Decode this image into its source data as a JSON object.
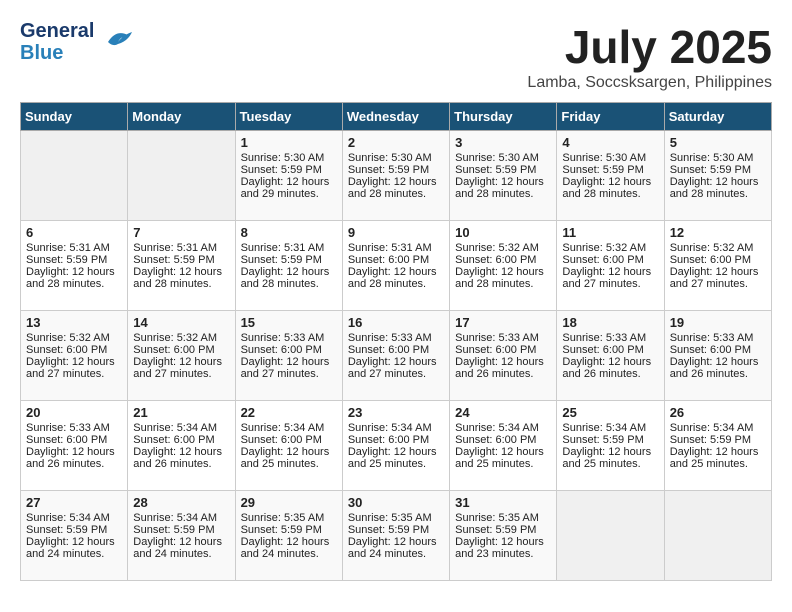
{
  "header": {
    "logo_line1": "General",
    "logo_line2": "Blue",
    "month": "July 2025",
    "location": "Lamba, Soccsksargen, Philippines"
  },
  "weekdays": [
    "Sunday",
    "Monday",
    "Tuesday",
    "Wednesday",
    "Thursday",
    "Friday",
    "Saturday"
  ],
  "weeks": [
    [
      {
        "day": "",
        "sunrise": "",
        "sunset": "",
        "daylight": ""
      },
      {
        "day": "",
        "sunrise": "",
        "sunset": "",
        "daylight": ""
      },
      {
        "day": "1",
        "sunrise": "Sunrise: 5:30 AM",
        "sunset": "Sunset: 5:59 PM",
        "daylight": "Daylight: 12 hours and 29 minutes."
      },
      {
        "day": "2",
        "sunrise": "Sunrise: 5:30 AM",
        "sunset": "Sunset: 5:59 PM",
        "daylight": "Daylight: 12 hours and 28 minutes."
      },
      {
        "day": "3",
        "sunrise": "Sunrise: 5:30 AM",
        "sunset": "Sunset: 5:59 PM",
        "daylight": "Daylight: 12 hours and 28 minutes."
      },
      {
        "day": "4",
        "sunrise": "Sunrise: 5:30 AM",
        "sunset": "Sunset: 5:59 PM",
        "daylight": "Daylight: 12 hours and 28 minutes."
      },
      {
        "day": "5",
        "sunrise": "Sunrise: 5:30 AM",
        "sunset": "Sunset: 5:59 PM",
        "daylight": "Daylight: 12 hours and 28 minutes."
      }
    ],
    [
      {
        "day": "6",
        "sunrise": "Sunrise: 5:31 AM",
        "sunset": "Sunset: 5:59 PM",
        "daylight": "Daylight: 12 hours and 28 minutes."
      },
      {
        "day": "7",
        "sunrise": "Sunrise: 5:31 AM",
        "sunset": "Sunset: 5:59 PM",
        "daylight": "Daylight: 12 hours and 28 minutes."
      },
      {
        "day": "8",
        "sunrise": "Sunrise: 5:31 AM",
        "sunset": "Sunset: 5:59 PM",
        "daylight": "Daylight: 12 hours and 28 minutes."
      },
      {
        "day": "9",
        "sunrise": "Sunrise: 5:31 AM",
        "sunset": "Sunset: 6:00 PM",
        "daylight": "Daylight: 12 hours and 28 minutes."
      },
      {
        "day": "10",
        "sunrise": "Sunrise: 5:32 AM",
        "sunset": "Sunset: 6:00 PM",
        "daylight": "Daylight: 12 hours and 28 minutes."
      },
      {
        "day": "11",
        "sunrise": "Sunrise: 5:32 AM",
        "sunset": "Sunset: 6:00 PM",
        "daylight": "Daylight: 12 hours and 27 minutes."
      },
      {
        "day": "12",
        "sunrise": "Sunrise: 5:32 AM",
        "sunset": "Sunset: 6:00 PM",
        "daylight": "Daylight: 12 hours and 27 minutes."
      }
    ],
    [
      {
        "day": "13",
        "sunrise": "Sunrise: 5:32 AM",
        "sunset": "Sunset: 6:00 PM",
        "daylight": "Daylight: 12 hours and 27 minutes."
      },
      {
        "day": "14",
        "sunrise": "Sunrise: 5:32 AM",
        "sunset": "Sunset: 6:00 PM",
        "daylight": "Daylight: 12 hours and 27 minutes."
      },
      {
        "day": "15",
        "sunrise": "Sunrise: 5:33 AM",
        "sunset": "Sunset: 6:00 PM",
        "daylight": "Daylight: 12 hours and 27 minutes."
      },
      {
        "day": "16",
        "sunrise": "Sunrise: 5:33 AM",
        "sunset": "Sunset: 6:00 PM",
        "daylight": "Daylight: 12 hours and 27 minutes."
      },
      {
        "day": "17",
        "sunrise": "Sunrise: 5:33 AM",
        "sunset": "Sunset: 6:00 PM",
        "daylight": "Daylight: 12 hours and 26 minutes."
      },
      {
        "day": "18",
        "sunrise": "Sunrise: 5:33 AM",
        "sunset": "Sunset: 6:00 PM",
        "daylight": "Daylight: 12 hours and 26 minutes."
      },
      {
        "day": "19",
        "sunrise": "Sunrise: 5:33 AM",
        "sunset": "Sunset: 6:00 PM",
        "daylight": "Daylight: 12 hours and 26 minutes."
      }
    ],
    [
      {
        "day": "20",
        "sunrise": "Sunrise: 5:33 AM",
        "sunset": "Sunset: 6:00 PM",
        "daylight": "Daylight: 12 hours and 26 minutes."
      },
      {
        "day": "21",
        "sunrise": "Sunrise: 5:34 AM",
        "sunset": "Sunset: 6:00 PM",
        "daylight": "Daylight: 12 hours and 26 minutes."
      },
      {
        "day": "22",
        "sunrise": "Sunrise: 5:34 AM",
        "sunset": "Sunset: 6:00 PM",
        "daylight": "Daylight: 12 hours and 25 minutes."
      },
      {
        "day": "23",
        "sunrise": "Sunrise: 5:34 AM",
        "sunset": "Sunset: 6:00 PM",
        "daylight": "Daylight: 12 hours and 25 minutes."
      },
      {
        "day": "24",
        "sunrise": "Sunrise: 5:34 AM",
        "sunset": "Sunset: 6:00 PM",
        "daylight": "Daylight: 12 hours and 25 minutes."
      },
      {
        "day": "25",
        "sunrise": "Sunrise: 5:34 AM",
        "sunset": "Sunset: 5:59 PM",
        "daylight": "Daylight: 12 hours and 25 minutes."
      },
      {
        "day": "26",
        "sunrise": "Sunrise: 5:34 AM",
        "sunset": "Sunset: 5:59 PM",
        "daylight": "Daylight: 12 hours and 25 minutes."
      }
    ],
    [
      {
        "day": "27",
        "sunrise": "Sunrise: 5:34 AM",
        "sunset": "Sunset: 5:59 PM",
        "daylight": "Daylight: 12 hours and 24 minutes."
      },
      {
        "day": "28",
        "sunrise": "Sunrise: 5:34 AM",
        "sunset": "Sunset: 5:59 PM",
        "daylight": "Daylight: 12 hours and 24 minutes."
      },
      {
        "day": "29",
        "sunrise": "Sunrise: 5:35 AM",
        "sunset": "Sunset: 5:59 PM",
        "daylight": "Daylight: 12 hours and 24 minutes."
      },
      {
        "day": "30",
        "sunrise": "Sunrise: 5:35 AM",
        "sunset": "Sunset: 5:59 PM",
        "daylight": "Daylight: 12 hours and 24 minutes."
      },
      {
        "day": "31",
        "sunrise": "Sunrise: 5:35 AM",
        "sunset": "Sunset: 5:59 PM",
        "daylight": "Daylight: 12 hours and 23 minutes."
      },
      {
        "day": "",
        "sunrise": "",
        "sunset": "",
        "daylight": ""
      },
      {
        "day": "",
        "sunrise": "",
        "sunset": "",
        "daylight": ""
      }
    ]
  ]
}
